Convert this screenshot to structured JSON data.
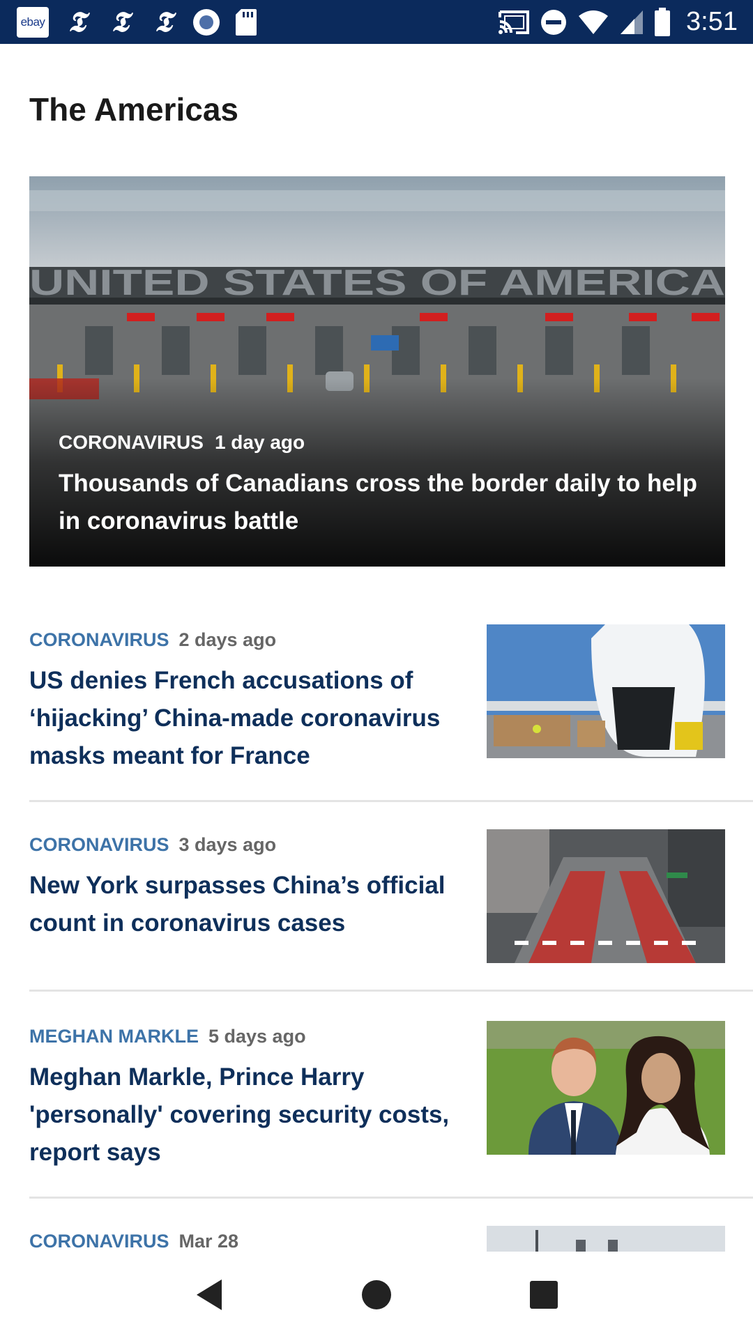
{
  "status_bar": {
    "ebay_label": "ebay",
    "nyt_glyph": "𝕿",
    "time": "3:51",
    "left_icons": [
      "ebay-icon",
      "nyt-icon",
      "nyt-icon",
      "nyt-icon",
      "radio-icon",
      "sd-card-icon"
    ],
    "right_icons": [
      "cast-icon",
      "do-not-disturb-icon",
      "wifi-icon",
      "cell-signal-icon",
      "battery-icon"
    ]
  },
  "section": {
    "title": "The Americas"
  },
  "hero": {
    "kicker": "CORONAVIRUS",
    "age": "1 day ago",
    "headline": "Thousands of Canadians cross the border daily to help in coronavirus battle",
    "sign_text": "UNITED STATES OF AMERICA"
  },
  "articles": [
    {
      "kicker": "CORONAVIRUS",
      "age": "2 days ago",
      "headline": "US denies French accusations of ‘hijacking’ China-made coronavirus masks meant for France"
    },
    {
      "kicker": "CORONAVIRUS",
      "age": "3 days ago",
      "headline": "New York surpasses China’s official count in coronavirus cases"
    },
    {
      "kicker": "MEGHAN MARKLE",
      "age": "5 days ago",
      "headline": "Meghan Markle, Prince Harry 'personally' covering security costs, report says"
    },
    {
      "kicker": "CORONAVIRUS",
      "age": "Mar 28",
      "headline": ""
    }
  ],
  "nav_bar": {
    "icons": [
      "back-icon",
      "home-icon",
      "recents-icon"
    ]
  },
  "colors": {
    "status_bar_bg": "#0b2a5c",
    "kicker": "#3d73a8",
    "headline": "#0e2f5a",
    "divider": "#e4e4e4"
  }
}
